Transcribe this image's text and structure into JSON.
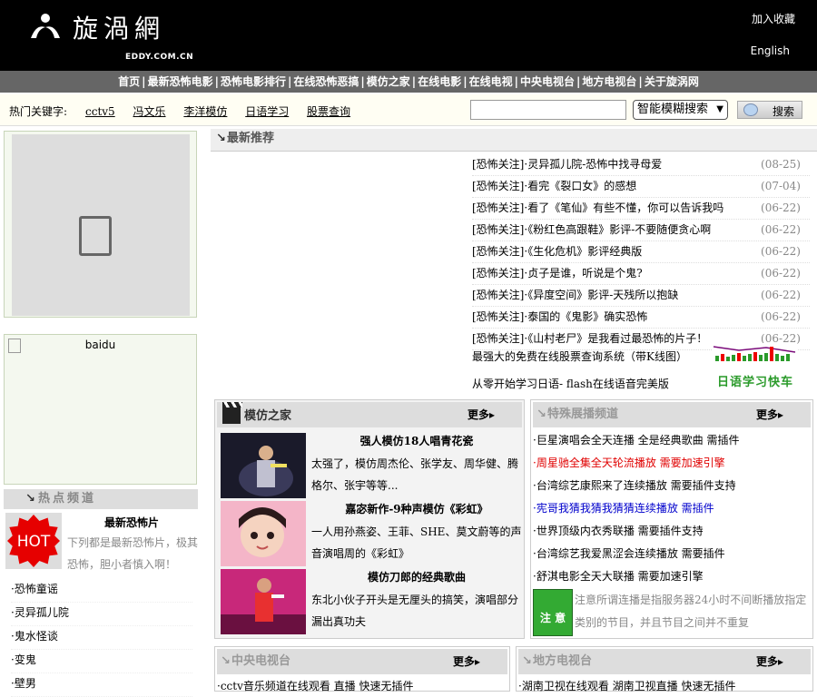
{
  "header": {
    "logo_text": "旋渦網",
    "logo_sub": "EDDY.COM.CN",
    "favorite": "加入收藏",
    "english": "English"
  },
  "nav": [
    "首页",
    "最新恐怖电影",
    "恐怖电影排行",
    "在线恐怖恶搞",
    "模仿之家",
    "在线电影",
    "在线电视",
    "中央电视台",
    "地方电视台",
    "关于旋涡网"
  ],
  "keywords": {
    "label": "热门关键字:",
    "items": [
      "cctv5",
      "冯文乐",
      "李洋模仿",
      "日语学习",
      "股票查询"
    ]
  },
  "search": {
    "input_value": "",
    "select_value": "智能模糊搜索",
    "button": "搜索"
  },
  "left": {
    "baidu_alt": "baidu",
    "hot_heading": "热点频道",
    "hot_badge": "HOT",
    "hot_title": "最新恐怖片",
    "hot_desc": "下列都是最新恐怖片，极其恐怖，胆小者慎入啊！",
    "hot_list": [
      "·恐怖童谣",
      "·灵异孤儿院",
      "·鬼水怪谈",
      "·变鬼",
      "·壁男"
    ]
  },
  "recommend": {
    "heading": "最新推荐",
    "items": [
      {
        "cat": "[恐怖关注]",
        "title": "·灵异孤儿院-恐怖中找寻母爱",
        "date": "(08-25)"
      },
      {
        "cat": "[恐怖关注]",
        "title": "·看完《裂口女》的感想",
        "date": "(07-04)"
      },
      {
        "cat": "[恐怖关注]",
        "title": "·看了《笔仙》有些不懂，你可以告诉我吗",
        "date": "(06-22)"
      },
      {
        "cat": "[恐怖关注]",
        "title": "·《粉红色高跟鞋》影评-不要随便贪心啊",
        "date": "(06-22)"
      },
      {
        "cat": "[恐怖关注]",
        "title": "·《生化危机》影评经典版",
        "date": "(06-22)"
      },
      {
        "cat": "[恐怖关注]",
        "title": "·贞子是谁，听说是个鬼?",
        "date": "(06-22)"
      },
      {
        "cat": "[恐怖关注]",
        "title": "·《异度空间》影评-天残所以抱缺",
        "date": "(06-22)"
      },
      {
        "cat": "[恐怖关注]",
        "title": "·泰国的《鬼影》确实恐怖",
        "date": "(06-22)"
      },
      {
        "cat": "[恐怖关注]",
        "title": "·《山村老尸》是我看过最恐怖的片子！",
        "date": "(06-22)"
      }
    ],
    "promo1": "最强大的免费在线股票查询系统（带K线图）",
    "promo2": "从零开始学习日语- flash在线语音完美版",
    "jp_logo": "日语学习快车"
  },
  "imitation": {
    "heading": "模仿之家",
    "more": "更多",
    "items": [
      {
        "title": "强人模仿18人唱青花瓷",
        "desc": "太强了，模仿周杰伦、张学友、周华健、腾格尔、张宇等等..."
      },
      {
        "title": "嘉宓新作-9种声模仿《彩虹》",
        "desc": "一人用孙燕姿、王菲、SHE、莫文蔚等的声音演唱周的《彩虹》"
      },
      {
        "title": "模仿刀郎的经典歌曲",
        "desc": "东北小伙子开头是无厘头的搞笑，演唱部分漏出真功夫"
      }
    ]
  },
  "special": {
    "heading": "特殊展播频道",
    "more": "更多",
    "items": [
      {
        "text": "·巨星演唱会全天连播 全是经典歌曲 需插件",
        "color": "normal"
      },
      {
        "text": "·周星驰全集全天轮流播放 需要加速引擎",
        "color": "red"
      },
      {
        "text": "·台湾综艺康熙来了连续播放 需要插件支持",
        "color": "normal"
      },
      {
        "text": "·宪哥我猜我猜我猜猜连续播放 需插件",
        "color": "blue"
      },
      {
        "text": "·世界顶级内衣秀联播 需要插件支持",
        "color": "normal"
      },
      {
        "text": "·台湾综艺我爱黑涩会连续播放 需要插件",
        "color": "normal"
      },
      {
        "text": "·舒淇电影全天大联播 需要加速引擎",
        "color": "normal"
      }
    ],
    "notice_img": "注 意",
    "notice": "注意所谓连播是指服务器24小时不间断播放指定类别的节目，并且节目之间并不重复"
  },
  "cctv": {
    "heading": "中央电视台",
    "more": "更多",
    "first_row": "·cctv音乐频道在线观看 直播 快速无插件"
  },
  "local": {
    "heading": "地方电视台",
    "more": "更多",
    "first_row": "·湖南卫视在线观看 湖南卫视直播 快速无插件"
  },
  "colors": {
    "header_bg": "#000000",
    "nav_bg": "#666666",
    "hot_red": "#e60000",
    "accent_red": "#e00000",
    "accent_blue": "#0000cc",
    "jp_green": "#2a9a2a"
  }
}
